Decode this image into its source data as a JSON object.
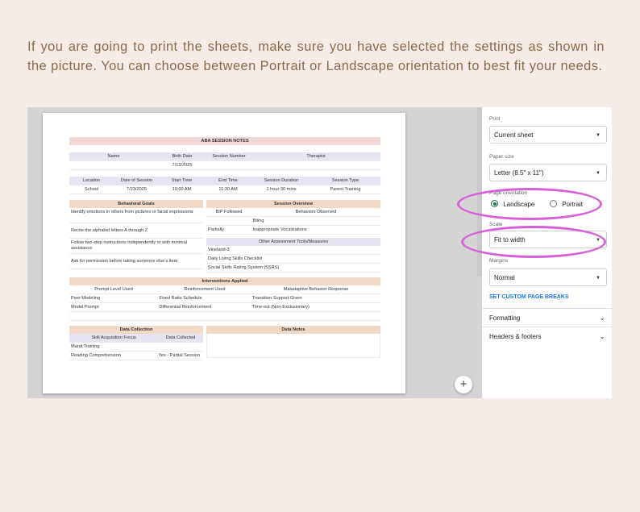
{
  "intro": "If you are going to print the sheets, make sure you have selected the settings as shown in the picture. You can choose between Portrait or Landscape orientation to best fit your needs.",
  "sheet": {
    "title": "ABA SESSION NOTES",
    "info1_headers": [
      "Name",
      "Birth Date",
      "Session Number",
      "Therapist"
    ],
    "info1_values": [
      "",
      "7/12/2025",
      "",
      ""
    ],
    "info2_headers": [
      "Location",
      "Date of Session",
      "Start Time",
      "End Time",
      "Session Duration",
      "Session Type"
    ],
    "info2_values": [
      "School",
      "7/23/2025",
      "10:00 AM",
      "11:30 AM",
      "1 hour 30 mins",
      "Parent Training"
    ],
    "behavioral_goals": {
      "title": "Behavioral Goals",
      "items": [
        "Identify emotions in others from pictures or facial expressions",
        "Recite the alphabet letters A through Z",
        "Follow two-step instructions independently or with minimal assistance",
        "Ask for permission before taking someone else's item"
      ]
    },
    "session_overview": {
      "title": "Session Overview",
      "headers": [
        "BIP Followed",
        "Behaviors Observed"
      ],
      "rows": [
        [
          "",
          "Biting"
        ],
        [
          "Partially",
          "Inappropriate Vocalizations"
        ]
      ],
      "tools_title": "Other Assessment Tools/Measures",
      "tools": [
        "Vineland-3",
        "Daily Living Skills Checklist",
        "Social Skills Rating System (SSRS)"
      ]
    },
    "interventions": {
      "title": "Interventions Applied",
      "headers": [
        "Prompt Level Used",
        "Reinforcement Used",
        "Maladaptive Behavior Response"
      ],
      "rows": [
        [
          "Peer Modeling",
          "Fixed Ratio Schedule",
          "Transition Support Given"
        ],
        [
          "Model Prompt",
          "Differential Reinforcement",
          "Time-out (Non-Exclusionary)"
        ]
      ]
    },
    "data_collection": {
      "title": "Data Collection",
      "headers": [
        "Skill Acquisition Focus",
        "Data Collected"
      ],
      "rows": [
        [
          "Mand Training",
          ""
        ],
        [
          "Reading Comprehension",
          "Yes - Partial Session"
        ]
      ]
    },
    "data_notes": {
      "title": "Data Notes"
    }
  },
  "fab_label": "+",
  "panel": {
    "print_label": "Print",
    "print_value": "Current sheet",
    "paper_label": "Paper size",
    "paper_value": "Letter (8.5\" x 11\")",
    "orientation_label": "Page orientation",
    "landscape": "Landscape",
    "portrait": "Portrait",
    "selected_orientation": "Landscape",
    "scale_label": "Scale",
    "scale_value": "Fit to width",
    "margins_label": "Margins",
    "margins_value": "Normal",
    "custom_breaks": "SET CUSTOM PAGE BREAKS",
    "formatting": "Formatting",
    "headers_footers": "Headers & footers"
  },
  "colors": {
    "background": "#f6ece7",
    "intro_text": "#8a6a48",
    "highlight": "#d85fd8",
    "radio_selected": "#1a7340",
    "link": "#1a73e8"
  },
  "icons": [
    "dropdown-caret-icon",
    "chevron-down-icon",
    "plus-icon",
    "radio-icon"
  ]
}
